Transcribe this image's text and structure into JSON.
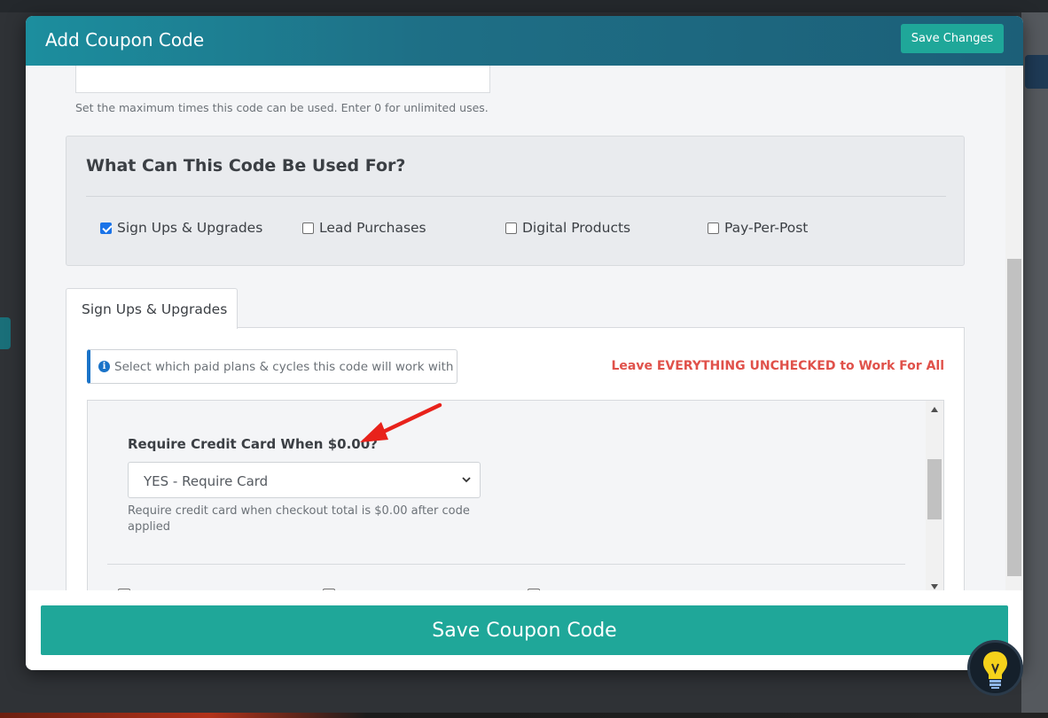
{
  "modal": {
    "title": "Add Coupon Code",
    "save_changes_label": "Save Changes",
    "save_coupon_label": "Save Coupon Code"
  },
  "max_uses": {
    "help": "Set the maximum times this code can be used. Enter 0 for unlimited uses."
  },
  "usage": {
    "title": "What Can This Code Be Used For?",
    "options": [
      {
        "label": "Sign Ups & Upgrades",
        "checked": true
      },
      {
        "label": "Lead Purchases",
        "checked": false
      },
      {
        "label": "Digital Products",
        "checked": false
      },
      {
        "label": "Pay-Per-Post",
        "checked": false
      }
    ]
  },
  "tabs": [
    {
      "label": "Sign Ups & Upgrades",
      "active": true
    }
  ],
  "plans": {
    "info": "Select which paid plans & cycles this code will work with",
    "warning": "Leave EVERYTHING UNCHECKED to Work For All",
    "require_card": {
      "label": "Require Credit Card When $0.00?",
      "selected": "YES - Require Card",
      "help": "Require credit card when checkout total is $0.00 after code applied"
    }
  },
  "colors": {
    "header": "#1c7f92",
    "accent": "#1fa799",
    "warning": "#e0514a",
    "annotation_arrow": "#e8221b"
  },
  "icons": {
    "info": "info-circle-icon",
    "select_caret": "chevron-down-icon",
    "help": "lightbulb-icon"
  }
}
